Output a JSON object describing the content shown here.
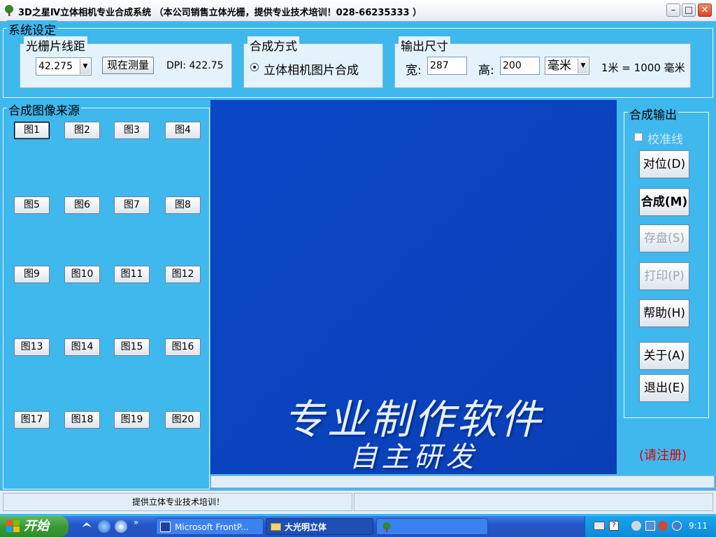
{
  "window": {
    "title": "3D之星Ⅳ立体相机专业合成系统 （本公司销售立体光栅，提供专业技术培训！028-66235333 ）",
    "controls": {
      "minimize": "–",
      "maximize": "□",
      "close": "✕"
    }
  },
  "settings": {
    "group_label": "系统设定",
    "grating": {
      "label": "光栅片线距",
      "value": "42.275",
      "measure_button": "现在测量",
      "dpi_text": "DPI: 422.75"
    },
    "method": {
      "label": "合成方式",
      "option": "立体相机图片合成"
    },
    "output_size": {
      "label": "输出尺寸",
      "width_label": "宽:",
      "width_value": "287",
      "height_label": "高:",
      "height_value": "200",
      "unit_value": "毫米",
      "note": "1米 = 1000 毫米"
    }
  },
  "sources": {
    "group_label": "合成图像来源",
    "buttons": [
      "图1",
      "图2",
      "图3",
      "图4",
      "图5",
      "图6",
      "图7",
      "图8",
      "图9",
      "图10",
      "图11",
      "图12",
      "图13",
      "图14",
      "图15",
      "图16",
      "图17",
      "图18",
      "图19",
      "图20"
    ]
  },
  "canvas": {
    "line1": "专业制作软件",
    "line2": "自主研发"
  },
  "output": {
    "group_label": "合成输出",
    "calibration_label": "校准线",
    "buttons": {
      "align": "对位(D)",
      "compose": "合成(M)",
      "save": "存盘(S)",
      "print": "打印(P)",
      "help": "帮助(H)",
      "about": "关于(A)",
      "exit": "退出(E)"
    },
    "register_text": "(请注册)"
  },
  "statusbar": {
    "text": "提供立体专业技术培训！"
  },
  "taskbar": {
    "start_label": "开始",
    "tasks": [
      "Microsoft FrontP...",
      "大光明立体",
      ""
    ],
    "clock": "9:11"
  },
  "colors": {
    "panel_bg": "#3fb8ee",
    "canvas_bg": "#0a45c0",
    "register_text": "#e00000"
  }
}
